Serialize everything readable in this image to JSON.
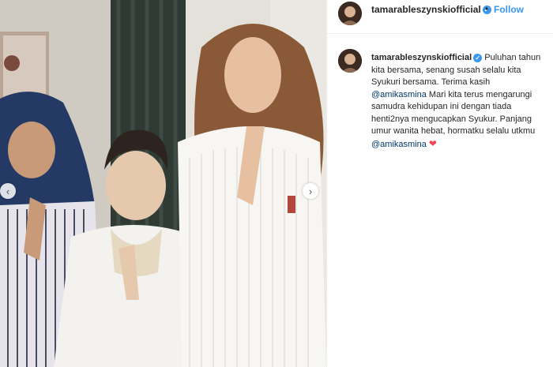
{
  "post": {
    "username": "tamarableszynskiofficial",
    "separator": "•",
    "follow_label": "Follow",
    "nav_prev": "‹",
    "nav_next": "›",
    "caption": {
      "text1": "Puluhan tahun kita bersama, senang susah selalu kita Syukuri bersama. Terima kasih",
      "mention1": "@amikasmina",
      "text2": "Mari kita terus mengarungi samudra kehidupan ini dengan tiada henti2nya mengucapkan Syukur. Panjang umur wanita hebat, hormatku selalu utkmu",
      "mention2": "@amikasmina",
      "heart": "❤"
    }
  },
  "colors": {
    "accent": "#3897f0",
    "mention": "#00376b",
    "heart": "#ed4956"
  }
}
